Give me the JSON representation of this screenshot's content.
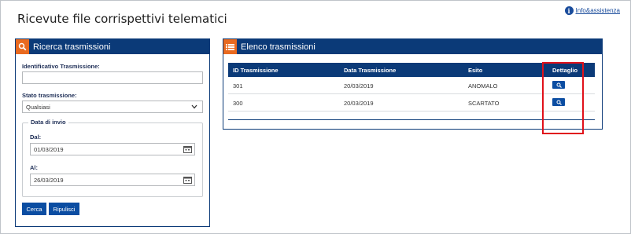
{
  "page_title": "Ricevute file corrispettivi telematici",
  "help_link": {
    "label": "Info&assistenza",
    "icon": "info-icon"
  },
  "search_panel": {
    "title": "Ricerca trasmissioni",
    "icon": "search-icon",
    "id_label": "Identificativo Trasmissione:",
    "id_value": "",
    "state_label": "Stato trasmissione:",
    "state_value": "Qualsiasi",
    "date_group_label": "Data di invio",
    "from_label": "Dal:",
    "from_value": "01/03/2019",
    "to_label": "Al:",
    "to_value": "26/03/2019",
    "search_button": "Cerca",
    "reset_button": "Ripulisci"
  },
  "list_panel": {
    "title": "Elenco trasmissioni",
    "icon": "list-icon",
    "columns": [
      "ID Trasmissione",
      "Data Trasmissione",
      "Esito",
      "Dettaglio"
    ],
    "rows": [
      {
        "id": "301",
        "date": "20/03/2019",
        "outcome": "ANOMALO"
      },
      {
        "id": "300",
        "date": "20/03/2019",
        "outcome": "SCARTATO"
      }
    ]
  },
  "colors": {
    "header_blue": "#0b3a78",
    "button_blue": "#0b4da2",
    "icon_orange": "#e96a20",
    "highlight_red": "#e0111a"
  }
}
